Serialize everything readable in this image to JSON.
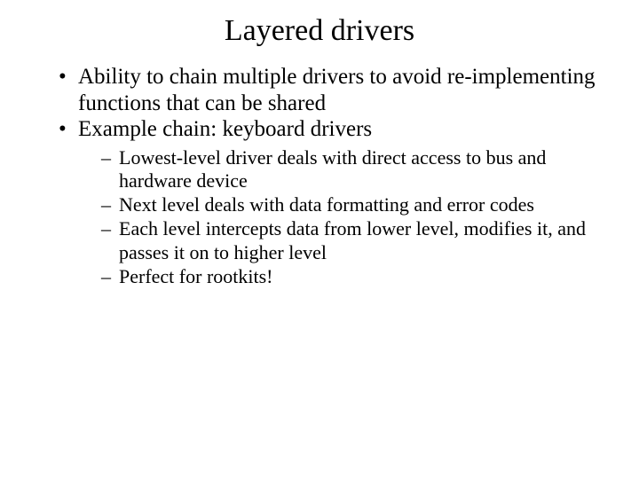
{
  "title": "Layered drivers",
  "bullets": [
    {
      "text": "Ability to chain multiple drivers to avoid re-implementing functions that can be shared"
    },
    {
      "text": "Example chain: keyboard drivers",
      "sub": [
        "Lowest-level driver deals with direct access to bus and hardware device",
        "Next level deals with data formatting and error codes",
        "Each level intercepts data from lower level, modifies it, and passes it on to higher level",
        "Perfect for rootkits!"
      ]
    }
  ]
}
